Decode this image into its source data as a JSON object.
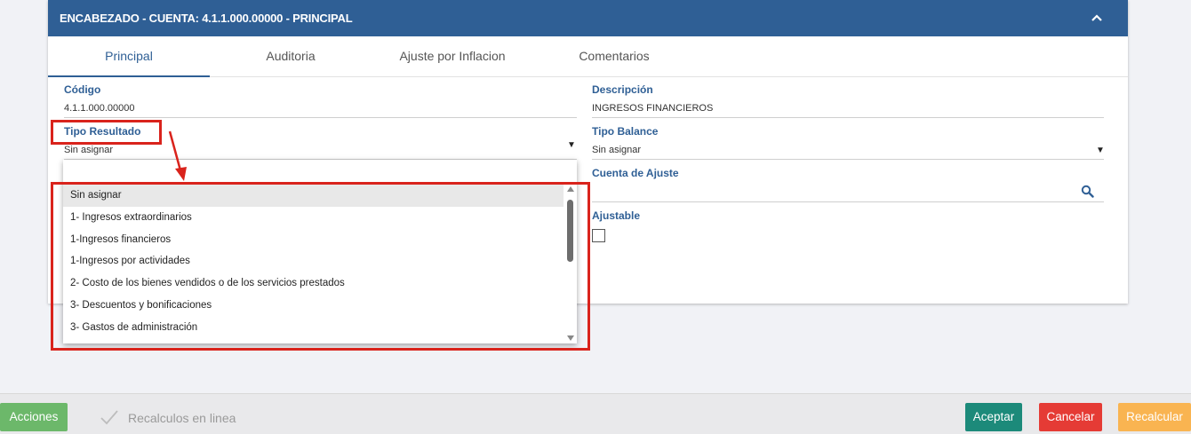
{
  "header": {
    "title": "ENCABEZADO - CUENTA: 4.1.1.000.00000 - PRINCIPAL",
    "collapse_icon": "chevron-up-icon"
  },
  "tabs": [
    {
      "label": "Principal",
      "active": true
    },
    {
      "label": "Auditoria",
      "active": false
    },
    {
      "label": "Ajuste por Inflacion",
      "active": false
    },
    {
      "label": "Comentarios",
      "active": false
    }
  ],
  "form": {
    "codigo": {
      "label": "Código",
      "value": "4.1.1.000.00000"
    },
    "descripcion": {
      "label": "Descripción",
      "value": "INGRESOS FINANCIEROS"
    },
    "tipo_resultado": {
      "label": "Tipo Resultado",
      "value": "Sin asignar"
    },
    "tipo_balance": {
      "label": "Tipo Balance",
      "value": "Sin asignar"
    },
    "cuenta_ajuste": {
      "label": "Cuenta de Ajuste",
      "value": "",
      "icon": "search-icon"
    },
    "ajustable": {
      "label": "Ajustable",
      "checked": false
    }
  },
  "dropdown": {
    "search_value": "",
    "options": [
      "Sin asignar",
      "1- Ingresos extraordinarios",
      "1-Ingresos financieros",
      "1-Ingresos por actividades",
      "2- Costo de los bienes vendidos o de los servicios prestados",
      "3- Descuentos y bonificaciones",
      "3- Gastos de administración"
    ],
    "selected_index": 0
  },
  "footer": {
    "acciones_label": "Acciones",
    "recalc_label": "Recalculos en linea",
    "recalc_icon": "check-icon",
    "aceptar_label": "Aceptar",
    "cancelar_label": "Cancelar",
    "recalcular_label": "Recalcular"
  },
  "colors": {
    "header_bg": "#2f5f95",
    "annotation_red": "#d9231c",
    "acciones": "#6cb86a",
    "aceptar": "#1c8a7a",
    "cancelar": "#e53b35",
    "recalcular": "#f9b451"
  }
}
